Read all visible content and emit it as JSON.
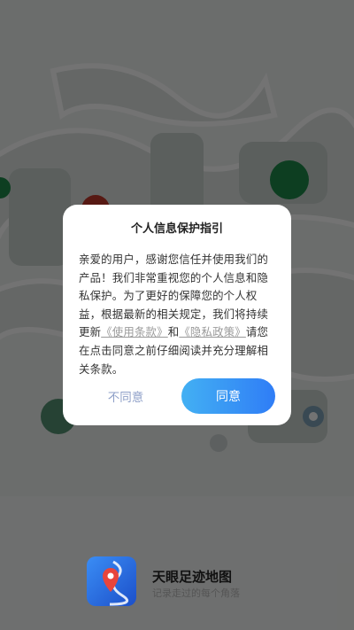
{
  "dialog": {
    "title": "个人信息保护指引",
    "body_prefix": "亲爱的用户，感谢您信任并使用我们的产品！我们非常重视您的个人信息和隐私保护。为了更好的保障您的个人权益，根据最新的相关规定，我们将持续更新",
    "terms_link": "《使用条款》",
    "and": "和",
    "privacy_link": "《隐私政策》",
    "body_suffix": "请您在点击同意之前仔细阅读并充分理解相关条款。",
    "disagree_label": "不同意",
    "agree_label": "同意"
  },
  "brand": {
    "app_name": "天眼足迹地图",
    "slogan": "记录走过的每个角落",
    "icon": "map-pin-icon"
  },
  "colors": {
    "accent_start": "#43b0f3",
    "accent_end": "#2f7df6",
    "disagree_text": "#8fa0c8"
  }
}
